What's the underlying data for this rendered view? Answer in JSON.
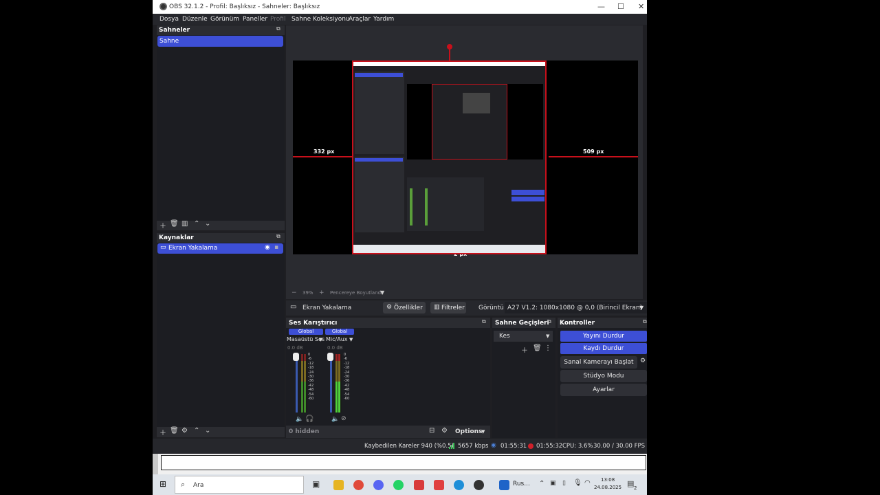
{
  "window": {
    "title": "OBS 32.1.2 - Profil: Başlıksız - Sahneler: Başlıksız",
    "controls": [
      "—",
      "☐",
      "✕"
    ]
  },
  "menu": [
    "Dosya",
    "Düzenle",
    "Görünüm",
    "Paneller",
    "Profil",
    "Sahne Koleksiyonu",
    "Araçlar",
    "Yardım"
  ],
  "scenes": {
    "title": "Sahneler",
    "items": [
      "Sahne"
    ]
  },
  "sources": {
    "title": "Kaynaklar",
    "items": [
      "Ekran Yakalama"
    ]
  },
  "preview": {
    "left_px": "332 px",
    "right_px": "509 px",
    "bottom_px": "2 px",
    "zoom": "39%",
    "fit_label": "Pencereye Boyutlandır"
  },
  "source_bar": {
    "source_name": "Ekran Yakalama",
    "properties": "Özellikler",
    "filters": "Filtreler",
    "display_label": "Görüntü",
    "display_value": "A27 V1.2: 1080x1080 @ 0,0 (Birincil Ekran)"
  },
  "mixer": {
    "title": "Ses Karıştırıcı",
    "channels": [
      {
        "badge": "Global",
        "name": "Masaüstü Ses",
        "db": "0.0 dB"
      },
      {
        "badge": "Global",
        "name": "Mic/Aux",
        "db": "0.0 dB"
      }
    ],
    "scale": [
      "0",
      "-6",
      "-12",
      "-18",
      "-24",
      "-30",
      "-36",
      "-42",
      "-48",
      "-54",
      "-60"
    ],
    "hidden": "0 hidden",
    "options": "Options"
  },
  "transitions": {
    "title": "Sahne Geçişleri",
    "value": "Kes"
  },
  "controls": {
    "title": "Kontroller",
    "buttons": [
      "Yayını Durdur",
      "Kaydı Durdur",
      "Sanal Kamerayı Başlat",
      "Stüdyo Modu",
      "Ayarlar"
    ]
  },
  "status": {
    "dropped": "Kaybedilen Kareler 940 (%0.5)",
    "bitrate": "5657 kbps",
    "stream_time": "01:55:31",
    "rec_time": "01:55:32",
    "cpu": "CPU: 3.6%",
    "fps": "30.00 / 30.00 FPS"
  },
  "taskbar": {
    "search": "Ara",
    "app_label": "Rus...",
    "time": "13:08",
    "date": "24.08.2025",
    "notif": "2"
  }
}
